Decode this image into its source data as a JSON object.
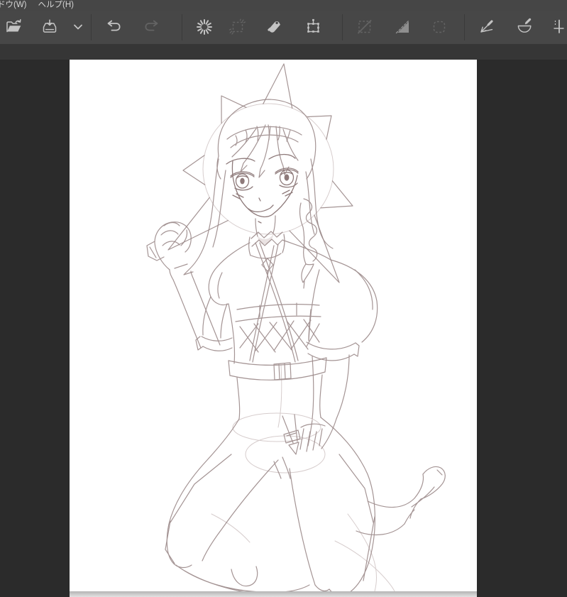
{
  "menu_bar": {
    "items": [
      {
        "label": "ドウ(W)"
      },
      {
        "label": "ヘルプ(H)"
      }
    ]
  },
  "toolbar": {
    "groups": [
      {
        "icons": [
          {
            "name": "open-file",
            "state": "enabled"
          },
          {
            "name": "save",
            "state": "enabled"
          },
          {
            "name": "save-options-chevron",
            "state": "enabled"
          }
        ]
      },
      {
        "icons": [
          {
            "name": "undo",
            "state": "enabled"
          },
          {
            "name": "redo",
            "state": "disabled"
          }
        ]
      },
      {
        "icons": [
          {
            "name": "deselect",
            "state": "enabled"
          },
          {
            "name": "invert-selection",
            "state": "disabled"
          },
          {
            "name": "fill-bucket",
            "state": "enabled"
          },
          {
            "name": "transform",
            "state": "enabled"
          }
        ]
      },
      {
        "icons": [
          {
            "name": "snap-off",
            "state": "disabled"
          },
          {
            "name": "snap-parallel",
            "state": "medium"
          },
          {
            "name": "snap-marquee",
            "state": "disabled"
          }
        ]
      },
      {
        "icons": [
          {
            "name": "snap-vanishing-point",
            "state": "enabled"
          },
          {
            "name": "snap-curve",
            "state": "enabled"
          },
          {
            "name": "snap-cross",
            "state": "enabled-clipped-at-window-edge"
          }
        ]
      }
    ]
  },
  "canvas": {
    "artwork_description": "Light pencil rough sketch of an anime-style girl kneeling on the ground, facing viewer; braided crown hairstyle with a side braid, large eyes, gentle smile, spiked star halo behind her head, high zigzag collar with diamond pendant, criss-cross chest straps, laced corset band with belt, puff sleeves, left fist raised holding a small stone, right hand resting between her thighs, one foot raised behind her.",
    "page_color": "#ffffff"
  },
  "colors": {
    "menubar_bg": "#464646",
    "toolbar_bg": "#474747",
    "toolbar_strip_bg": "#363636",
    "workspace_bg": "#2b2b2b",
    "canvas_bg": "#ffffff",
    "separator": "#3a3a3a",
    "icon_enabled": "#c3c3c3",
    "icon_medium": "#8f8f8f",
    "icon_disabled": "#636363",
    "menu_text": "#d4d4d4",
    "sketch_line": "#9b8989",
    "sketch_line_dark": "#8e7a7a",
    "sketch_construction": "#c9bcbc",
    "canvas_bottom_edge": "#e2e2e2"
  }
}
